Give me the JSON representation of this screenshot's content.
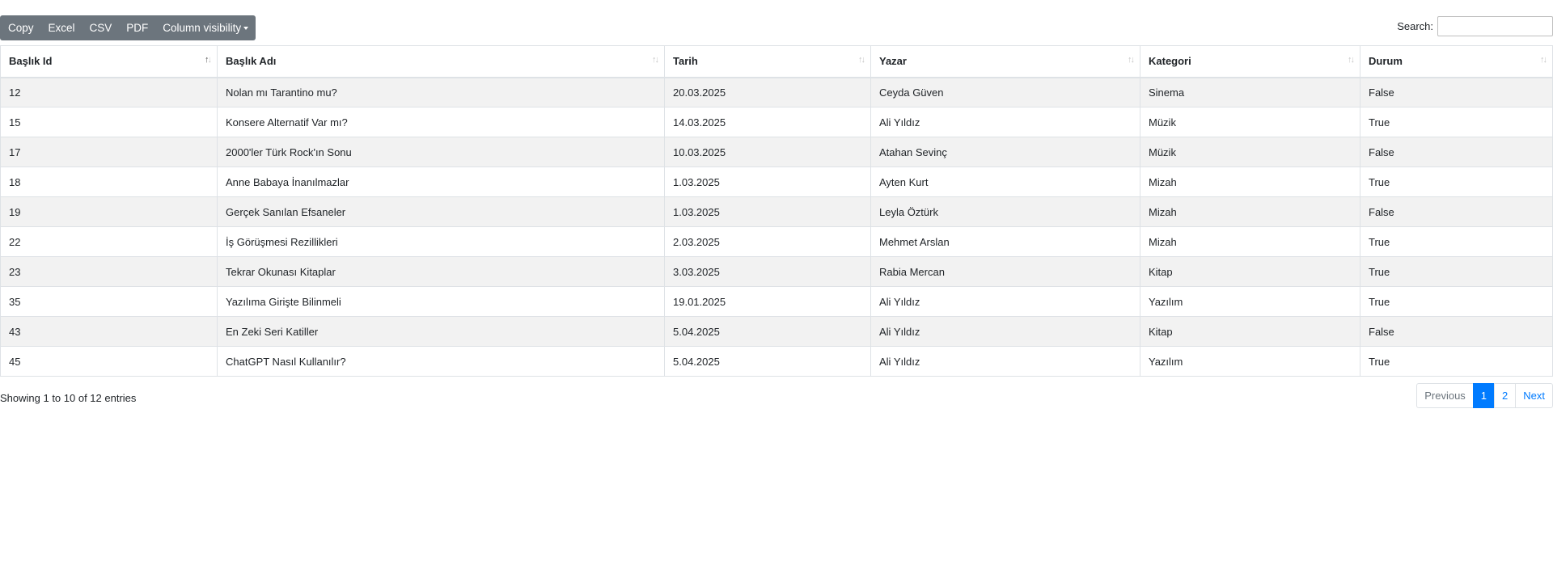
{
  "toolbar": {
    "copy": "Copy",
    "excel": "Excel",
    "csv": "CSV",
    "pdf": "PDF",
    "column_visibility": "Column visibility"
  },
  "search": {
    "label": "Search:",
    "value": ""
  },
  "table": {
    "columns": [
      "Başlık Id",
      "Başlık Adı",
      "Tarih",
      "Yazar",
      "Kategori",
      "Durum"
    ],
    "sorted_column": "Başlık Id",
    "rows": [
      [
        "12",
        "Nolan mı Tarantino mu?",
        "20.03.2025",
        "Ceyda Güven",
        "Sinema",
        "False"
      ],
      [
        "15",
        "Konsere Alternatif Var mı?",
        "14.03.2025",
        "Ali Yıldız",
        "Müzik",
        "True"
      ],
      [
        "17",
        "2000'ler Türk Rock'ın Sonu",
        "10.03.2025",
        "Atahan Sevinç",
        "Müzik",
        "False"
      ],
      [
        "18",
        "Anne Babaya İnanılmazlar",
        "1.03.2025",
        "Ayten Kurt",
        "Mizah",
        "True"
      ],
      [
        "19",
        "Gerçek Sanılan Efsaneler",
        "1.03.2025",
        "Leyla Öztürk",
        "Mizah",
        "False"
      ],
      [
        "22",
        "İş Görüşmesi Rezillikleri",
        "2.03.2025",
        "Mehmet Arslan",
        "Mizah",
        "True"
      ],
      [
        "23",
        "Tekrar Okunası Kitaplar",
        "3.03.2025",
        "Rabia Mercan",
        "Kitap",
        "True"
      ],
      [
        "35",
        "Yazılıma Girişte Bilinmeli",
        "19.01.2025",
        "Ali Yıldız",
        "Yazılım",
        "True"
      ],
      [
        "43",
        "En Zeki Seri Katiller",
        "5.04.2025",
        "Ali Yıldız",
        "Kitap",
        "False"
      ],
      [
        "45",
        "ChatGPT Nasıl Kullanılır?",
        "5.04.2025",
        "Ali Yıldız",
        "Yazılım",
        "True"
      ]
    ]
  },
  "footer": {
    "info": "Showing 1 to 10 of 12 entries",
    "previous": "Previous",
    "pages": [
      "1",
      "2"
    ],
    "current_page": "1",
    "next": "Next"
  },
  "colors": {
    "toolbar_bg": "#6c757d",
    "active_page": "#007bff",
    "stripe": "#f2f2f2"
  }
}
